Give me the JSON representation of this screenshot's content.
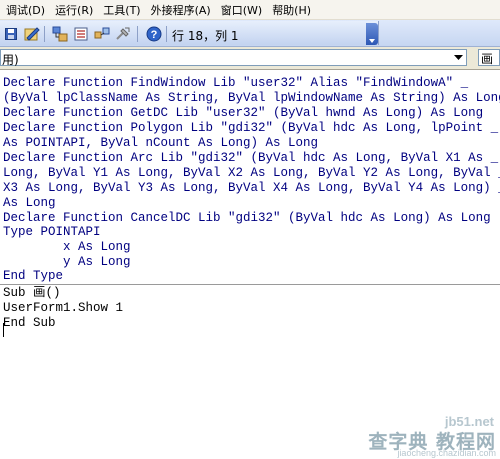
{
  "menubar": {
    "items": [
      "调试(D)",
      "运行(R)",
      "工具(T)",
      "外接程序(A)",
      "窗口(W)",
      "帮助(H)"
    ]
  },
  "toolbar": {
    "position_label": "行 18，列 1",
    "icons": [
      "save-icon",
      "design-mode-icon",
      "project-explorer-icon",
      "properties-window-icon",
      "object-browser-icon",
      "toolbox-icon",
      "help-icon"
    ]
  },
  "selectors": {
    "object_value": "用)",
    "procedure_value": "画"
  },
  "code": {
    "lines": [
      "Declare Function FindWindow Lib \"user32\" Alias \"FindWindowA\" _",
      "(ByVal lpClassName As String, ByVal lpWindowName As String) As Long",
      "Declare Function GetDC Lib \"user32\" (ByVal hwnd As Long) As Long",
      "Declare Function Polygon Lib \"gdi32\" (ByVal hdc As Long, lpPoint _",
      "As POINTAPI, ByVal nCount As Long) As Long",
      "Declare Function Arc Lib \"gdi32\" (ByVal hdc As Long, ByVal X1 As _",
      "Long, ByVal Y1 As Long, ByVal X2 As Long, ByVal Y2 As Long, ByVal _",
      "X3 As Long, ByVal Y3 As Long, ByVal X4 As Long, ByVal Y4 As Long) _",
      "As Long",
      "Declare Function CancelDC Lib \"gdi32\" (ByVal hdc As Long) As Long",
      "Type POINTAPI",
      "        x As Long",
      "        y As Long",
      "End Type",
      "Sub 画()",
      "UserForm1.Show 1",
      "End Sub"
    ]
  },
  "watermark": {
    "site": "jb51.net",
    "main": "查字典 教程网",
    "sub": "jiaocheng.chazidian.com"
  }
}
